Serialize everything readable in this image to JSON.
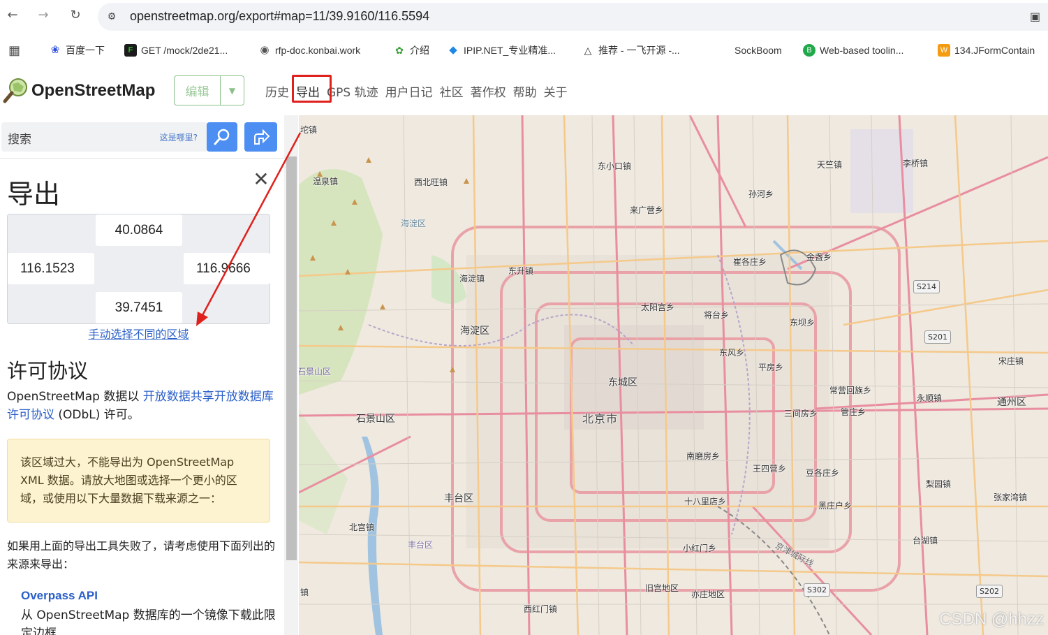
{
  "browser": {
    "url": "openstreetmap.org/export#map=11/39.9160/116.5594",
    "bookmarks": [
      {
        "label": "",
        "icon": "apps-grid-icon"
      },
      {
        "label": "百度一下",
        "icon": "baidu-paw-icon"
      },
      {
        "label": "GET /mock/2de21...",
        "icon": "terminal-icon"
      },
      {
        "label": "rfp-doc.konbai.work",
        "icon": "globe-icon"
      },
      {
        "label": "介绍",
        "icon": "leaf-icon"
      },
      {
        "label": "IPIP.NET_专业精准...",
        "icon": "diamond-icon"
      },
      {
        "label": "推荐 - 一飞开源 -...",
        "icon": "triangle-icon"
      },
      {
        "label": "SockBoom",
        "icon": ""
      },
      {
        "label": "Web-based toolin...",
        "icon": "b-circle-icon"
      },
      {
        "label": "134.JFormContain",
        "icon": "w-square-icon"
      }
    ]
  },
  "header": {
    "logo_text": "OpenStreetMap",
    "edit_label": "编辑",
    "nav": [
      "历史",
      "导出",
      "GPS 轨迹",
      "用户日记",
      "社区",
      "著作权",
      "帮助",
      "关于"
    ]
  },
  "sidebar": {
    "search_placeholder": "搜索",
    "where_is_this": "这是哪里?",
    "title": "导出",
    "coords": {
      "top": "40.0864",
      "left": "116.1523",
      "right": "116.9666",
      "bottom": "39.7451"
    },
    "manual_select": "手动选择不同的区域",
    "license_heading": "许可协议",
    "license_pre": "OpenStreetMap 数据以 ",
    "license_link": "开放数据共享开放数据库许可协议",
    "license_post": " (ODbL) 许可。",
    "warning": "该区域过大，不能导出为 OpenStreetMap XML 数据。请放大地图或选择一个更小的区域，或使用以下大量数据下载来源之一：",
    "fallback": "如果用上面的导出工具失败了，请考虑使用下面列出的来源来导出：",
    "overpass_heading": "Overpass API",
    "overpass_text": "从 OpenStreetMap 数据库的一个镜像下载此限定边框"
  },
  "map": {
    "labels": {
      "tuozhen": "坨镇",
      "wenquan": "温泉镇",
      "xibeiwang": "西北旺镇",
      "dongxiaokou": "东小口镇",
      "tianzhu": "天竺镇",
      "liqiao": "李桥镇",
      "sunhe": "孙河乡",
      "laiguangying": "来广营乡",
      "haidian_park": "海淀区",
      "haidianzhen": "海淀镇",
      "dongsheng": "东升镇",
      "cuigezhuang": "崔各庄乡",
      "jinzhan": "金盏乡",
      "taiyanggong": "太阳宫乡",
      "jiangtai": "将台乡",
      "dongba": "东坝乡",
      "haidian": "海淀区",
      "dongfeng": "东风乡",
      "pingfang": "平房乡",
      "dongcheng": "东城区",
      "shijingshan_s": "石景山区",
      "changying": "常营回族乡",
      "songzhuang": "宋庄镇",
      "yongshun": "永顺镇",
      "tongzhou": "通州区",
      "shijingshan": "石景山区",
      "beijing": "北京市",
      "sanjianfang": "三间房乡",
      "guanzhuang": "管庄乡",
      "nanmofang": "南磨房乡",
      "wangsiying": "王四营乡",
      "dougezhuang": "豆各庄乡",
      "liyuan": "梨园镇",
      "fengtai": "丰台区",
      "shibalidian": "十八里店乡",
      "heizhuanghu": "黑庄户乡",
      "zhangjiawan": "张家湾镇",
      "beigong": "北宫镇",
      "fengtai_s": "丰台区",
      "xiaohongmen": "小红门乡",
      "taihu": "台湖镇",
      "jiugongdi": "旧宫地区",
      "yizhuang": "亦庄地区",
      "xihongmen": "西红门镇",
      "jing_w": "镇",
      "jingjin": "京津城际线"
    },
    "shields": [
      "S214",
      "S201",
      "S302",
      "S202"
    ],
    "watermark": "CSDN @hhzz"
  }
}
